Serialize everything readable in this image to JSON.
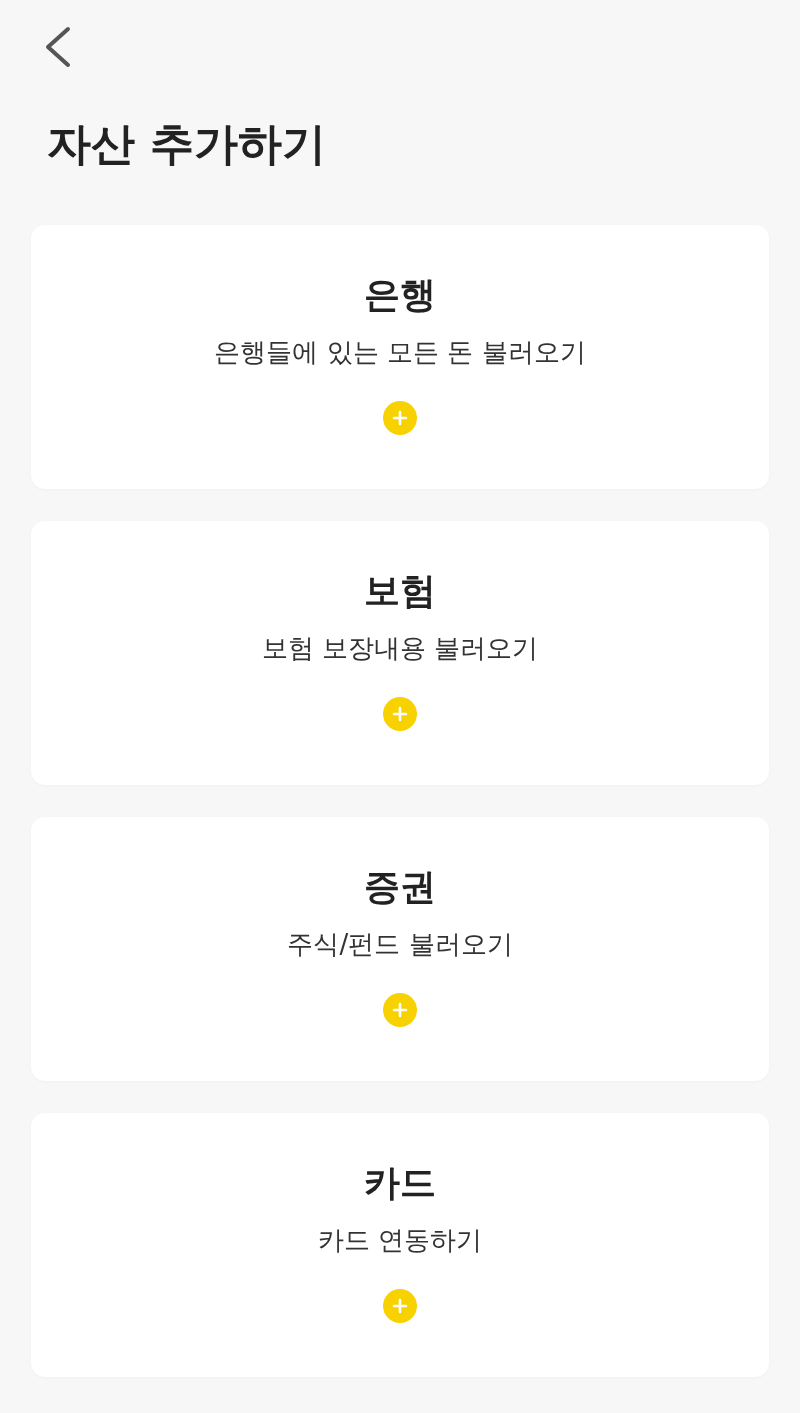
{
  "header": {
    "title": "자산 추가하기"
  },
  "cards": [
    {
      "title": "은행",
      "description": "은행들에 있는 모든 돈 불러오기"
    },
    {
      "title": "보험",
      "description": "보험 보장내용 불러오기"
    },
    {
      "title": "증권",
      "description": "주식/펀드 불러오기"
    },
    {
      "title": "카드",
      "description": "카드 연동하기"
    }
  ]
}
